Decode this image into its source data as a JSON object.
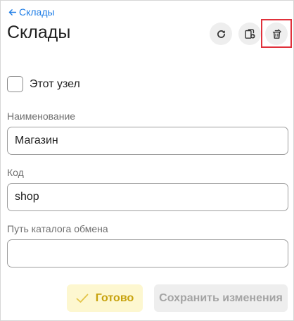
{
  "header": {
    "back_label": "Склады",
    "title": "Склады",
    "toolbar": {
      "refresh_icon": "refresh-icon",
      "copy_icon": "copy-add-icon",
      "delete_icon": "delete-icon"
    },
    "highlight_color": "#e0313b"
  },
  "form": {
    "checkbox": {
      "label": "Этот узел",
      "checked": false
    },
    "fields": [
      {
        "label": "Наименование",
        "value": "Магазин",
        "placeholder": ""
      },
      {
        "label": "Код",
        "value": "shop",
        "placeholder": ""
      },
      {
        "label": "Путь каталога обмена",
        "value": "",
        "placeholder": ""
      }
    ]
  },
  "footer": {
    "done_label": "Готово",
    "save_label": "Сохранить изменения"
  },
  "colors": {
    "accent": "#1e7de6",
    "done_text": "#c7a20c",
    "done_bg": "#fdf7d0"
  }
}
